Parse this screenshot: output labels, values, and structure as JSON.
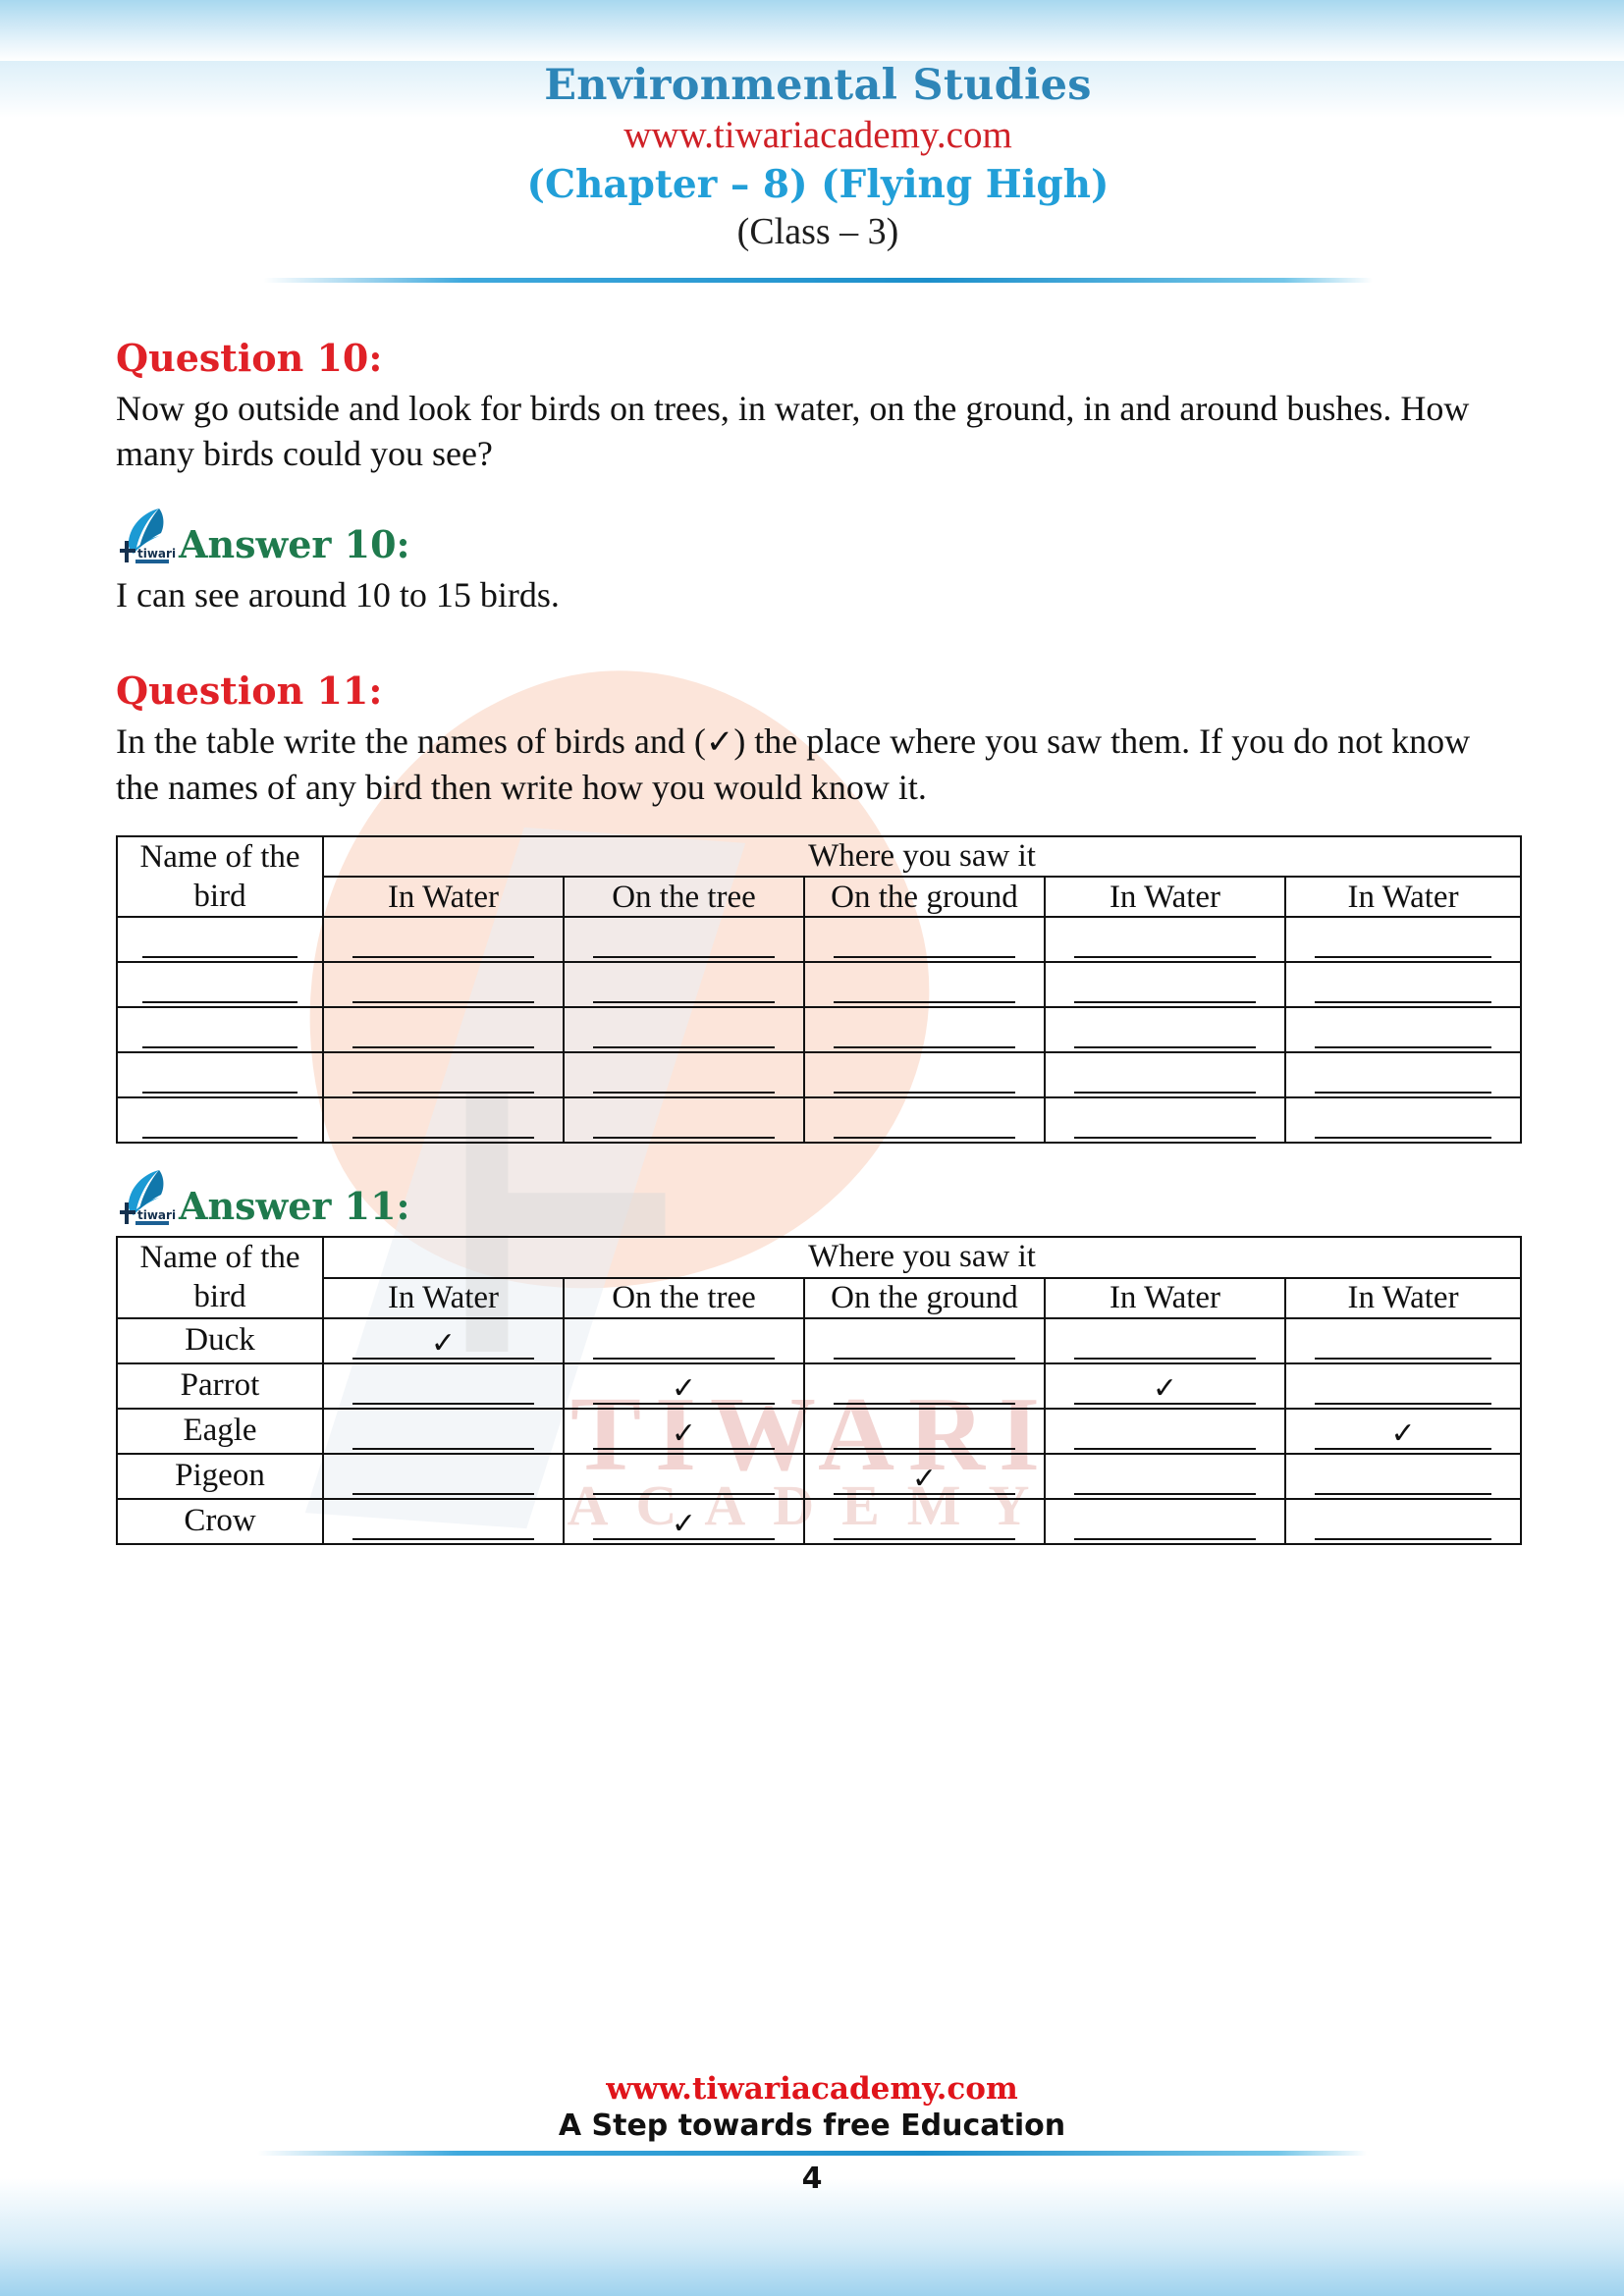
{
  "header": {
    "subject": "Environmental Studies",
    "website": "www.tiwariacademy.com",
    "chapter": "(Chapter – 8) (Flying High)",
    "class": "(Class – 3)"
  },
  "colors": {
    "subject_blue": "#2e86b8",
    "chapter_blue": "#229fd8",
    "url_red": "#cf2026",
    "question_red": "#e02127",
    "answer_green": "#1f7a4d",
    "rule_blue": "#1c8fcb",
    "watermark_peach": "#fbe0d4",
    "watermark_pink": "#f2d4d2"
  },
  "question10": {
    "heading": "Question 10:",
    "text": "Now go outside and look for birds on trees, in water, on the ground, in and around bushes. How many birds could you see?"
  },
  "answer10": {
    "heading": "Answer 10:",
    "text": "I can see around 10 to 15  birds."
  },
  "question11": {
    "heading": "Question 11:",
    "text_before_tick": "In the table write the names of birds and (",
    "tick": "✓",
    "text_after_tick": ") the place where you saw them. If you do not know the names of any bird then write how you would know it."
  },
  "answer11": {
    "heading": "Answer 11:"
  },
  "table": {
    "name_header": "Name of the bird",
    "span_header": "Where you saw it",
    "columns": [
      "In Water",
      "On the tree",
      "On the ground",
      "In Water",
      "In Water"
    ],
    "blank_row_count": 5
  },
  "answer_table": {
    "name_header": "Name of the bird",
    "span_header": "Where you saw it",
    "columns": [
      "In Water",
      "On the tree",
      "On the ground",
      "In Water",
      "In Water"
    ],
    "rows": [
      {
        "bird": "Duck",
        "marks": [
          true,
          false,
          false,
          false,
          false
        ]
      },
      {
        "bird": "Parrot",
        "marks": [
          false,
          true,
          false,
          true,
          false
        ]
      },
      {
        "bird": "Eagle",
        "marks": [
          false,
          true,
          false,
          false,
          true
        ]
      },
      {
        "bird": "Pigeon",
        "marks": [
          false,
          false,
          true,
          false,
          false
        ]
      },
      {
        "bird": "Crow",
        "marks": [
          false,
          true,
          false,
          false,
          false
        ]
      }
    ],
    "check_glyph": "✓"
  },
  "watermark": {
    "brand": "TIWARI",
    "sub": "ACADEMY"
  },
  "logo": {
    "wordmark": "tiwari"
  },
  "footer": {
    "url": "www.tiwariacademy.com",
    "tagline": "A Step towards free Education",
    "page_number": "4"
  }
}
